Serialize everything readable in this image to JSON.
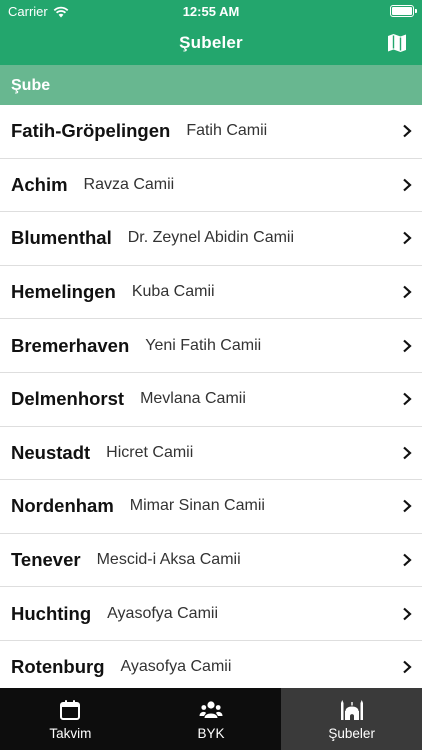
{
  "status_bar": {
    "carrier": "Carrier",
    "time": "12:55 AM"
  },
  "nav": {
    "title": "Şubeler",
    "map_icon": "map-icon"
  },
  "section": {
    "header": "Şube"
  },
  "branches": [
    {
      "name": "Fatih-Gröpelingen",
      "mosque": "Fatih Camii"
    },
    {
      "name": "Achim",
      "mosque": "Ravza Camii"
    },
    {
      "name": "Blumenthal",
      "mosque": "Dr. Zeynel Abidin Camii"
    },
    {
      "name": "Hemelingen",
      "mosque": "Kuba Camii"
    },
    {
      "name": "Bremerhaven",
      "mosque": "Yeni Fatih Camii"
    },
    {
      "name": "Delmenhorst",
      "mosque": "Mevlana Camii"
    },
    {
      "name": "Neustadt",
      "mosque": "Hicret Camii"
    },
    {
      "name": "Nordenham",
      "mosque": "Mimar Sinan Camii"
    },
    {
      "name": "Tenever",
      "mosque": "Mescid-i Aksa Camii"
    },
    {
      "name": "Huchting",
      "mosque": "Ayasofya Camii"
    },
    {
      "name": "Rotenburg",
      "mosque": "Ayasofya Camii"
    }
  ],
  "tabs": [
    {
      "label": "Takvim",
      "icon": "calendar-icon",
      "active": false
    },
    {
      "label": "BYK",
      "icon": "users-icon",
      "active": false
    },
    {
      "label": "Şubeler",
      "icon": "mosque-icon",
      "active": true
    }
  ],
  "colors": {
    "nav_bg": "#23a66d",
    "section_bg": "#68b790",
    "tabbar_bg": "#0d0d0d",
    "tab_active_bg": "#3a3a3a"
  }
}
